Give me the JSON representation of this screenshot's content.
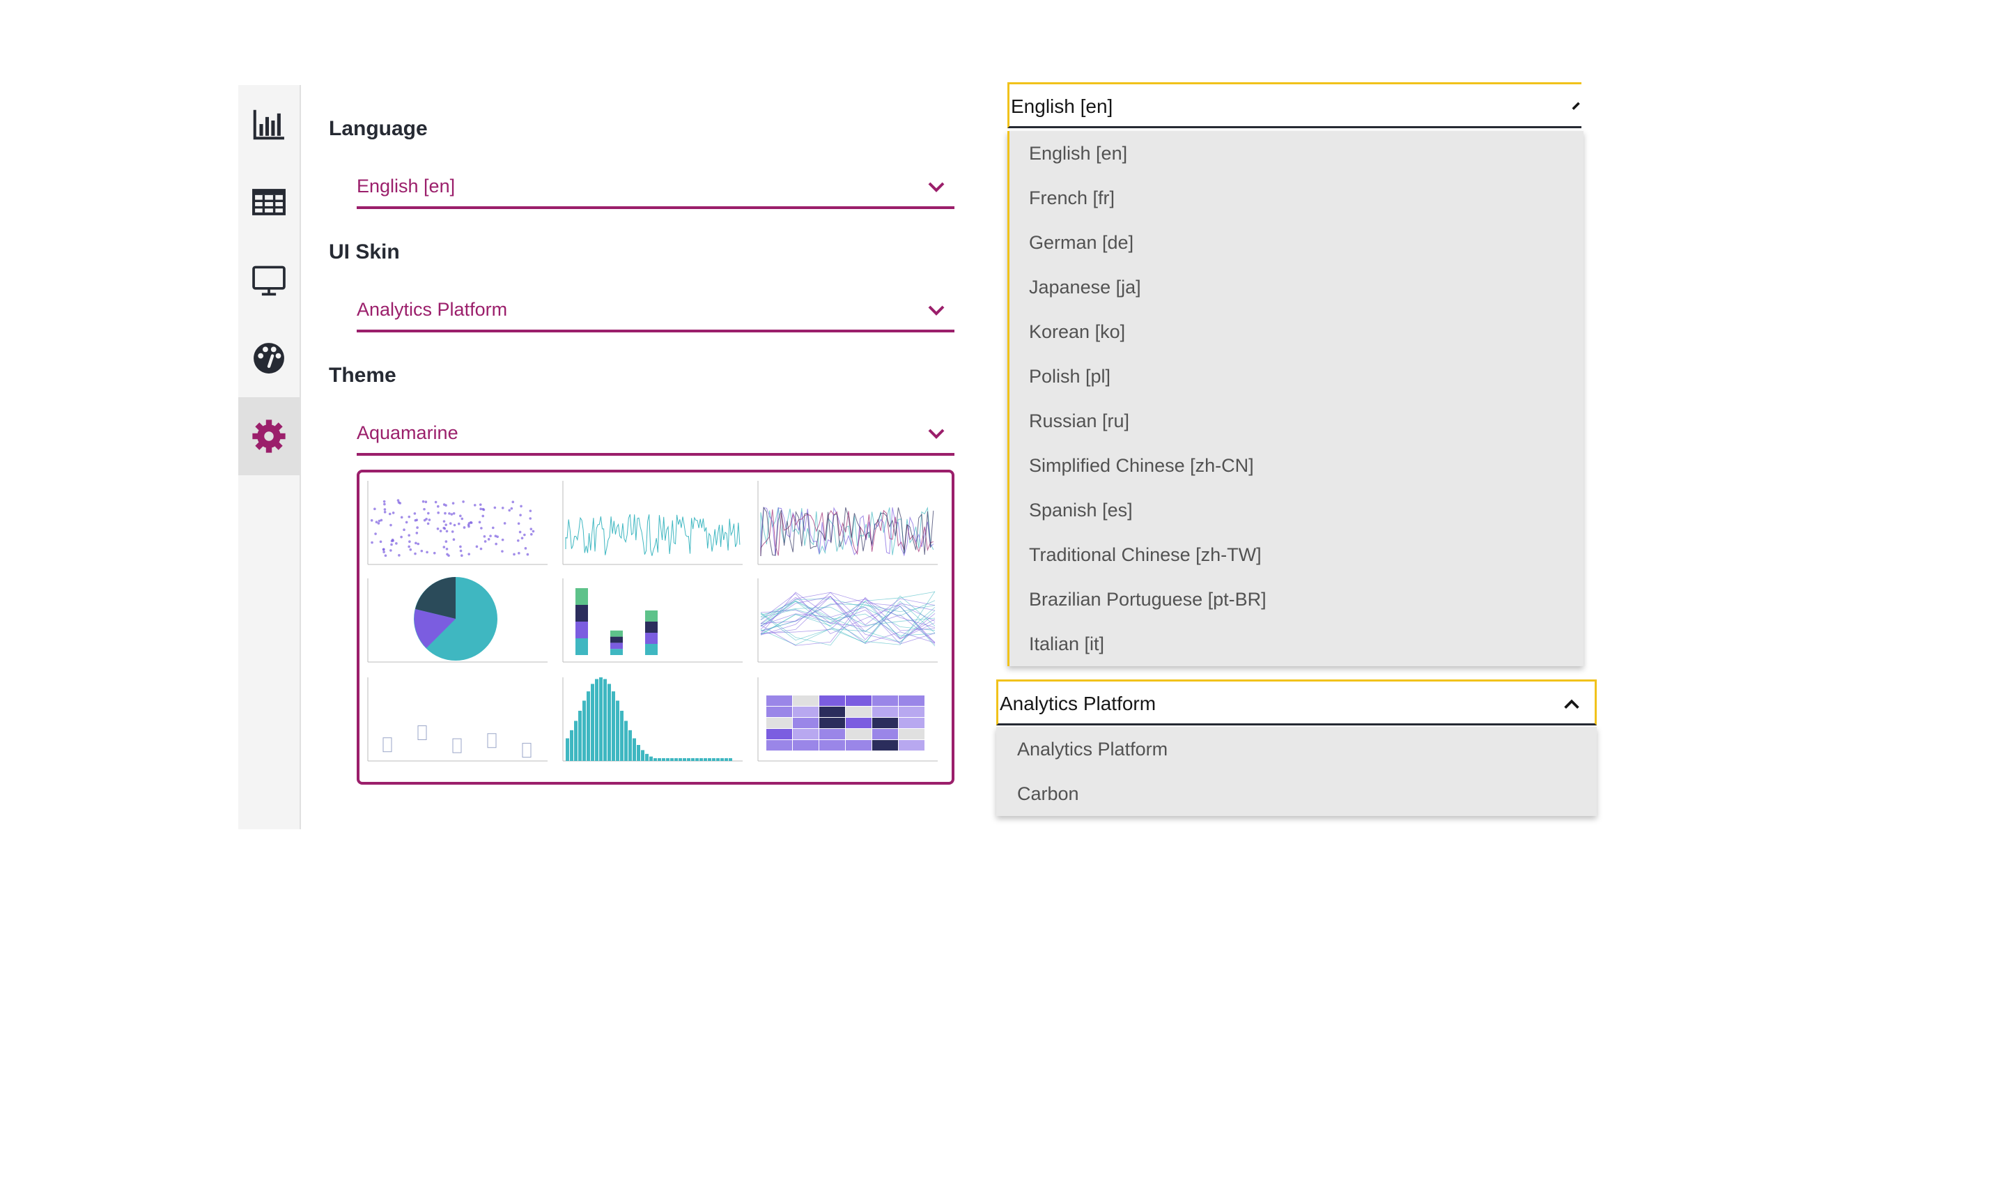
{
  "sidebar": {
    "items": [
      {
        "name": "charts",
        "icon": "bar-chart-icon"
      },
      {
        "name": "table",
        "icon": "table-icon"
      },
      {
        "name": "display",
        "icon": "monitor-icon"
      },
      {
        "name": "themes",
        "icon": "palette-icon"
      },
      {
        "name": "settings",
        "icon": "gear-icon",
        "active": true
      }
    ]
  },
  "settings": {
    "language_label": "Language",
    "language_value": "English [en]",
    "skin_label": "UI Skin",
    "skin_value": "Analytics Platform",
    "theme_label": "Theme",
    "theme_value": "Aquamarine"
  },
  "language_dropdown": {
    "selected": "English [en]",
    "options": [
      "English [en]",
      "French [fr]",
      "German [de]",
      "Japanese [ja]",
      "Korean [ko]",
      "Polish [pl]",
      "Russian [ru]",
      "Simplified Chinese [zh-CN]",
      "Spanish [es]",
      "Traditional Chinese [zh-TW]",
      "Brazilian Portuguese [pt-BR]",
      "Italian [it]"
    ]
  },
  "skin_dropdown": {
    "selected": "Analytics Platform",
    "options": [
      "Analytics Platform",
      "Carbon"
    ]
  },
  "colors": {
    "accent": "#9b1f6b",
    "focus": "#f1c21b",
    "teal": "#3fb7c1",
    "purple": "#7b5de0",
    "navy": "#2b2d5c"
  }
}
